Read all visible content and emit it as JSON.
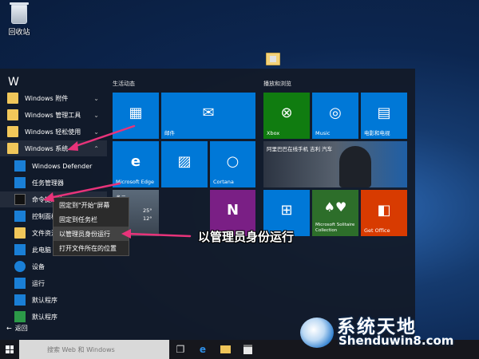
{
  "desktop": {
    "recycle_bin_label": "回收站"
  },
  "start_menu": {
    "list_letter": "W",
    "apps": [
      {
        "label": "Windows 附件",
        "icon": "folder-icon",
        "chevron": "⌄"
      },
      {
        "label": "Windows 管理工具",
        "icon": "folder-icon",
        "chevron": "⌄"
      },
      {
        "label": "Windows 轻松使用",
        "icon": "folder-icon",
        "chevron": "⌄"
      },
      {
        "label": "Windows 系统",
        "icon": "folder-icon",
        "chevron": "⌃"
      },
      {
        "label": "Windows Defender",
        "icon": "defender-icon"
      },
      {
        "label": "任务管理器",
        "icon": "task-manager-icon"
      },
      {
        "label": "命令提示符",
        "icon": "cmd-icon"
      },
      {
        "label": "控制面板",
        "icon": "control-panel-icon"
      },
      {
        "label": "文件资源管理器",
        "icon": "file-explorer-icon"
      },
      {
        "label": "此电脑",
        "icon": "this-pc-icon"
      },
      {
        "label": "设备",
        "icon": "devices-gear-icon"
      },
      {
        "label": "运行",
        "icon": "run-icon"
      },
      {
        "label": "默认程序",
        "icon": "default-programs-icon"
      },
      {
        "label": "默认程序",
        "icon": "default-programs-icon"
      }
    ],
    "back_label": "返回",
    "groups": {
      "left": "生活动态",
      "right": "播放和浏览"
    },
    "tiles": {
      "calendar": {
        "label": "",
        "color": "#0078d7"
      },
      "mail": {
        "label": "邮件",
        "color": "#0078d7"
      },
      "edge": {
        "label": "Microsoft Edge",
        "color": "#0078d7"
      },
      "photos": {
        "label": "",
        "color": "#0078d7"
      },
      "cortana": {
        "label": "Cortana",
        "color": "#0078d7"
      },
      "weather_city": "多云",
      "weather_temp_hi": "25°",
      "weather_temp_lo": "12°",
      "onenote": {
        "label": "",
        "color": "#7a1f85"
      },
      "xbox": {
        "label": "Xbox",
        "color": "#107c10"
      },
      "music": {
        "label": "Music",
        "color": "#0078d7"
      },
      "movies": {
        "label": "电影和电视",
        "color": "#0078d7"
      },
      "news_headline": "阿里巴巴在线手机 吉利 汽车",
      "store": {
        "label": "",
        "color": "#0078d7"
      },
      "solitaire": {
        "label": "Microsoft Solitaire Collection",
        "color": "#2d6e2a"
      },
      "get_office": {
        "label": "Get Office",
        "color": "#d83b01"
      }
    }
  },
  "context_menu": {
    "items": [
      "固定到\"开始\"屏幕",
      "固定到任务栏",
      "以管理员身份运行",
      "打开文件所在的位置"
    ]
  },
  "annotation_text": "以管理员身份运行",
  "taskbar": {
    "search_placeholder": "搜索 Web 和 Windows"
  },
  "watermark": {
    "chinese": "系统天地",
    "english": "Shenduwin8.com"
  }
}
